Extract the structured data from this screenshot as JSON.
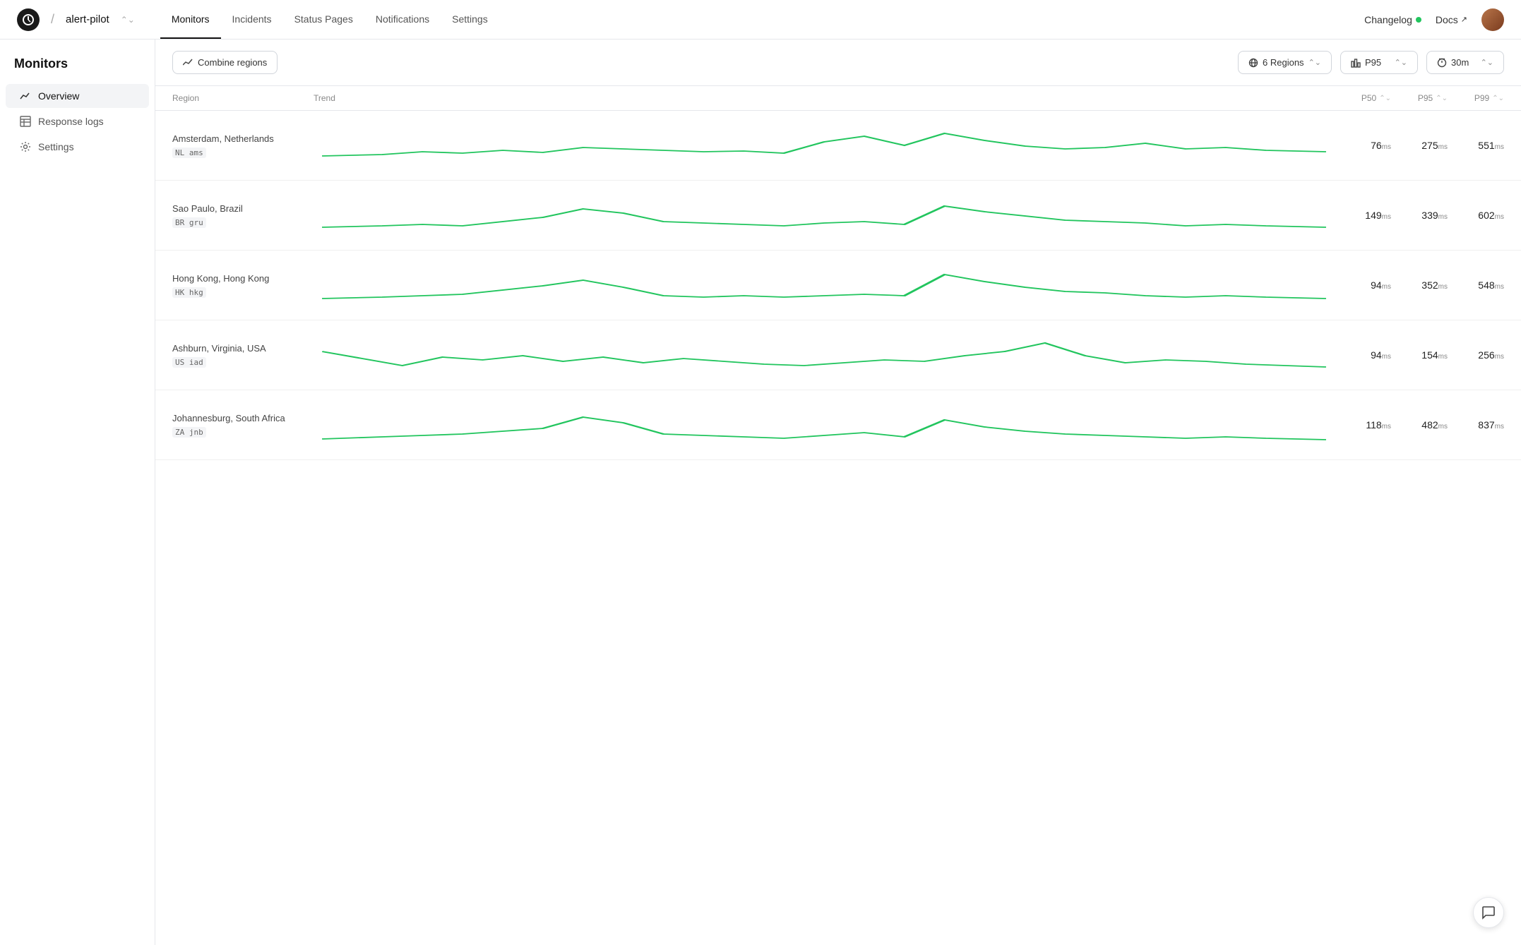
{
  "app": {
    "logo_alt": "S",
    "slash": "/",
    "app_name": "alert-pilot"
  },
  "nav": {
    "links": [
      {
        "label": "Monitors",
        "active": true
      },
      {
        "label": "Incidents",
        "active": false
      },
      {
        "label": "Status Pages",
        "active": false
      },
      {
        "label": "Notifications",
        "active": false
      },
      {
        "label": "Settings",
        "active": false
      }
    ],
    "changelog_label": "Changelog",
    "docs_label": "Docs"
  },
  "sidebar": {
    "title": "Monitors",
    "items": [
      {
        "label": "Overview",
        "icon": "chart-icon",
        "active": true
      },
      {
        "label": "Response logs",
        "icon": "table-icon",
        "active": false
      },
      {
        "label": "Settings",
        "icon": "gear-icon",
        "active": false
      }
    ]
  },
  "toolbar": {
    "combine_regions_label": "Combine regions",
    "regions_label": "6 Regions",
    "p95_label": "P95",
    "time_label": "30m"
  },
  "table": {
    "columns": [
      {
        "label": "Region",
        "sortable": false
      },
      {
        "label": "Trend",
        "sortable": false
      },
      {
        "label": "P50",
        "sortable": true
      },
      {
        "label": "P95",
        "sortable": true
      },
      {
        "label": "P99",
        "sortable": true
      }
    ],
    "rows": [
      {
        "region_name": "Amsterdam, Netherlands",
        "region_code": "NL ams",
        "p50": "76",
        "p50_unit": "ms",
        "p95": "275",
        "p95_unit": "ms",
        "p99": "551",
        "p99_unit": "ms",
        "sparkline_id": "ams"
      },
      {
        "region_name": "Sao Paulo, Brazil",
        "region_code": "BR gru",
        "p50": "149",
        "p50_unit": "ms",
        "p95": "339",
        "p95_unit": "ms",
        "p99": "602",
        "p99_unit": "ms",
        "sparkline_id": "gru"
      },
      {
        "region_name": "Hong Kong, Hong Kong",
        "region_code": "HK hkg",
        "p50": "94",
        "p50_unit": "ms",
        "p95": "352",
        "p95_unit": "ms",
        "p99": "548",
        "p99_unit": "ms",
        "sparkline_id": "hkg"
      },
      {
        "region_name": "Ashburn, Virginia, USA",
        "region_code": "US iad",
        "p50": "94",
        "p50_unit": "ms",
        "p95": "154",
        "p95_unit": "ms",
        "p99": "256",
        "p99_unit": "ms",
        "sparkline_id": "iad"
      },
      {
        "region_name": "Johannesburg, South Africa",
        "region_code": "ZA jnb",
        "p50": "118",
        "p50_unit": "ms",
        "p95": "482",
        "p95_unit": "ms",
        "p99": "837",
        "p99_unit": "ms",
        "sparkline_id": "jnb"
      }
    ]
  },
  "chat_btn_icon": "chat-icon"
}
